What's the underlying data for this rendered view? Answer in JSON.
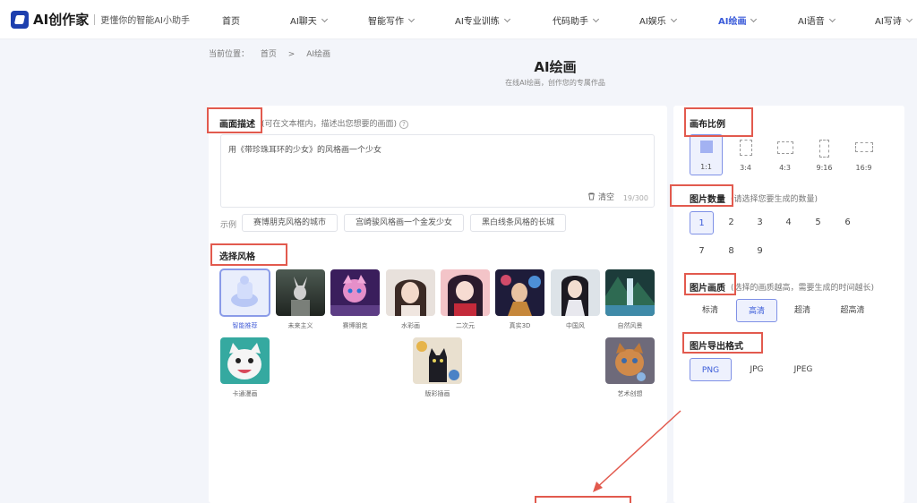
{
  "header": {
    "logo_text": "AI创作家",
    "slogan": "更懂你的智能AI小助手",
    "nav": [
      {
        "label": "首页",
        "dropdown": false
      },
      {
        "label": "AI聊天",
        "dropdown": true
      },
      {
        "label": "智能写作",
        "dropdown": true
      },
      {
        "label": "AI专业训练",
        "dropdown": true
      },
      {
        "label": "代码助手",
        "dropdown": true
      },
      {
        "label": "AI娱乐",
        "dropdown": true
      },
      {
        "label": "AI绘画",
        "dropdown": true,
        "active": true
      },
      {
        "label": "AI语音",
        "dropdown": true
      },
      {
        "label": "AI写诗",
        "dropdown": true
      }
    ]
  },
  "breadcrumb": {
    "prefix": "当前位置：",
    "home": "首页",
    "sep": ">",
    "current": "AI绘画"
  },
  "page": {
    "title": "AI绘画",
    "subtitle": "在线AI绘画，创作您的专属作品"
  },
  "description": {
    "title": "画面描述",
    "hint": "(可在文本框内，描述出您想要的画面)",
    "help_icon": "?",
    "value": "用《带珍珠耳环的少女》的风格画一个少女",
    "clear_label": "清空",
    "counter": "19/300"
  },
  "examples": {
    "label": "示例",
    "items": [
      "赛博朋克风格的城市",
      "宫崎骏风格画一个金发少女",
      "黑白线条风格的长城"
    ]
  },
  "styles": {
    "title": "选择风格",
    "items": [
      {
        "label": "智能推荐",
        "selected": true
      },
      {
        "label": "未来主义"
      },
      {
        "label": "赛博朋克"
      },
      {
        "label": "水彩画"
      },
      {
        "label": "二次元"
      },
      {
        "label": "真实3D"
      },
      {
        "label": "中国风"
      },
      {
        "label": "自然风景"
      },
      {
        "label": "卡通漫画"
      },
      {
        "label": "版彩插画"
      },
      {
        "label": "艺术创想"
      }
    ]
  },
  "ratio": {
    "title": "画布比例",
    "items": [
      {
        "label": "1:1",
        "selected": true
      },
      {
        "label": "3:4"
      },
      {
        "label": "4:3"
      },
      {
        "label": "9:16"
      },
      {
        "label": "16:9"
      }
    ]
  },
  "count": {
    "title": "图片数量",
    "hint": "(请选择您要生成的数量)",
    "items": [
      "1",
      "2",
      "3",
      "4",
      "5",
      "6",
      "7",
      "8",
      "9"
    ],
    "selected": "1"
  },
  "quality": {
    "title": "图片画质",
    "hint": "(选择的画质越高，需要生成的时间越长)",
    "items": [
      "标清",
      "高清",
      "超清",
      "超高清"
    ],
    "selected": "高清"
  },
  "format": {
    "title": "图片导出格式",
    "items": [
      "PNG",
      "JPG",
      "JPEG"
    ],
    "selected": "PNG"
  },
  "colors": {
    "accent": "#3a5bd9",
    "annotation": "#e25a4e"
  }
}
